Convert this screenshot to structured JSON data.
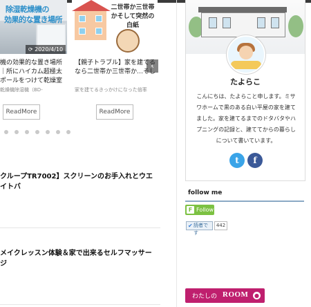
{
  "carousel": {
    "card1": {
      "image_caption_line1": "除湿乾燥機の",
      "image_caption_line2": "効果的な置き場所",
      "date": "2020/4/10",
      "title": "機の効果的な置き場所｜所にハイカム超極太ポールをつけて乾燥室に",
      "excerpt": "乾燥機除湿機（BD-",
      "read_more": "ReadMore"
    },
    "card2": {
      "image_caption": "二世帯か三世帯かそして突然の白紙",
      "title": "【親子トラブル】家を建てるなら二世帯か三世帯か…そして突然の白紙",
      "excerpt": "家を建てるきっかけになった倍率",
      "read_more": "ReadMore"
    },
    "next_arrow": "‹"
  },
  "posts": [
    {
      "title": "クループTR7002】スクリーンのお手入れとウエイトバ"
    },
    {
      "title": "メイクレッスン体験＆家で出来るセルフマッサージ"
    }
  ],
  "profile": {
    "name": "たよらこ",
    "bio": "こんにちは、たよらこと申します。ミサワホームで黒のある白い平屋の家を建てました。家を建てるまでのドタバタやハプニングの記録と、建ててからの暮らしについて書いています。",
    "twitter_icon": "t",
    "facebook_icon": "f"
  },
  "follow": {
    "title": "follow me",
    "follow_label": "Follow",
    "follow_icon": "F",
    "reader_label": "読者です",
    "reader_icon": "✔",
    "reader_count": "442"
  },
  "room_banner": {
    "prefix": "わたしの",
    "brand": "ROOM",
    "icon": "●"
  }
}
